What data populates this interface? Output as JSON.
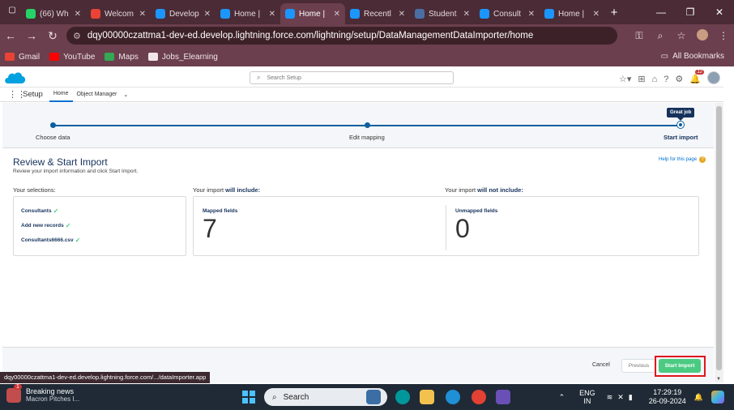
{
  "browser": {
    "tabs": [
      {
        "label": "(66) Wh",
        "favicon_color": "#25d366",
        "active": false
      },
      {
        "label": "Welcom",
        "favicon_color": "#ea4335",
        "active": false
      },
      {
        "label": "Develop",
        "favicon_color": "#1b96ff",
        "active": false
      },
      {
        "label": "Home |",
        "favicon_color": "#1b96ff",
        "active": false
      },
      {
        "label": "Home |",
        "favicon_color": "#1b96ff",
        "active": true
      },
      {
        "label": "Recentl",
        "favicon_color": "#1b96ff",
        "active": false
      },
      {
        "label": "Student",
        "favicon_color": "#4a6fa5",
        "active": false
      },
      {
        "label": "Consult",
        "favicon_color": "#1b96ff",
        "active": false
      },
      {
        "label": "Home |",
        "favicon_color": "#1b96ff",
        "active": false
      }
    ],
    "new_tab": "+",
    "window_controls": {
      "minimize": "—",
      "maximize": "❐",
      "close": "✕"
    },
    "url": "dqy00000czattma1-dev-ed.develop.lightning.force.com/lightning/setup/DataManagementDataImporter/home",
    "bookmarks": [
      {
        "label": "Gmail",
        "color": "#ea4335"
      },
      {
        "label": "YouTube",
        "color": "#ff0000"
      },
      {
        "label": "Maps",
        "color": "#34a853"
      },
      {
        "label": "Jobs_Elearning",
        "color": "#f0e6e9"
      }
    ],
    "all_bookmarks": "All Bookmarks",
    "status_url": "dqy00000czattma1-dev-ed.develop.lightning.force.com/.../dataImporter.app"
  },
  "salesforce": {
    "search_placeholder": "Search Setup",
    "notification_count": "12",
    "app_name": "Setup",
    "nav_tabs": [
      {
        "label": "Home",
        "active": true
      },
      {
        "label": "Object Manager",
        "active": false
      }
    ]
  },
  "wizard": {
    "badge": "Great job",
    "steps": [
      {
        "label": "Choose data",
        "current": false
      },
      {
        "label": "Edit mapping",
        "current": false
      },
      {
        "label": "Start import",
        "current": true
      }
    ],
    "title": "Review & Start Import",
    "subtitle": "Review your import information and click Start Import.",
    "help_link": "Help for this page",
    "selections_heading": "Your selections:",
    "will_include_prefix": "Your import ",
    "will_include_bold": "will include:",
    "will_not_include_prefix": "Your import ",
    "will_not_include_bold": "will not include:",
    "selections": [
      "Consultants",
      "Add new records",
      "Consultants6666.csv"
    ],
    "mapped_label": "Mapped fields",
    "mapped_count": "7",
    "unmapped_label": "Unmapped fields",
    "unmapped_count": "0"
  },
  "footer": {
    "cancel": "Cancel",
    "previous": "Previous",
    "start_import": "Start Import"
  },
  "taskbar": {
    "news_badge": "1",
    "news_title": "Breaking news",
    "news_subtitle": "Macron Pitches I...",
    "search_label": "Search",
    "lang_top": "ENG",
    "lang_bottom": "IN",
    "time": "17:29:19",
    "date": "26-09-2024"
  },
  "colors": {
    "accent": "#0070d2",
    "success": "#4bca81",
    "highlight_box": "#e0161d",
    "browser_frame": "#6b3f4e"
  }
}
